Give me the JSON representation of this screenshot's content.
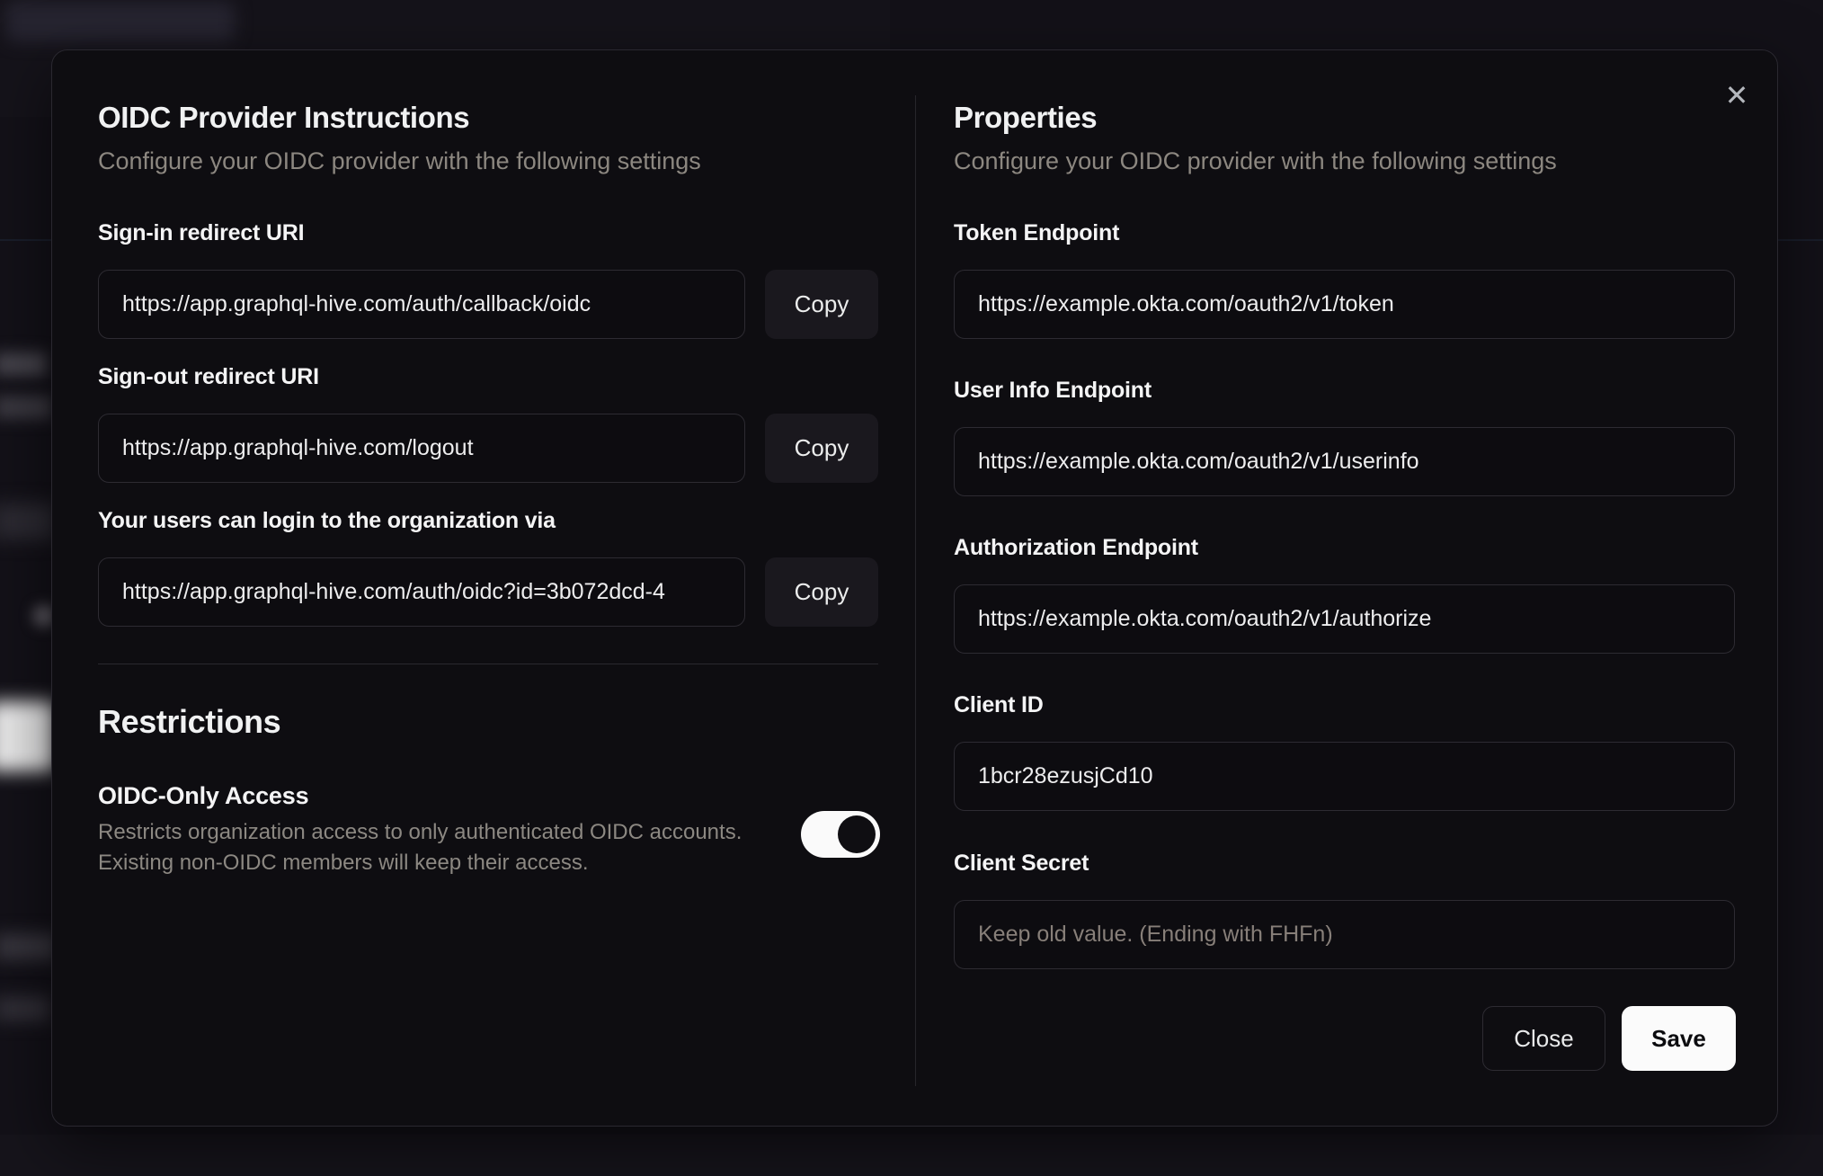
{
  "modal": {
    "close_icon": "✕",
    "left": {
      "title": "OIDC Provider Instructions",
      "subtitle": "Configure your OIDC provider with the following settings",
      "fields": [
        {
          "label": "Sign-in redirect URI",
          "value": "https://app.graphql-hive.com/auth/callback/oidc",
          "copy_label": "Copy"
        },
        {
          "label": "Sign-out redirect URI",
          "value": "https://app.graphql-hive.com/logout",
          "copy_label": "Copy"
        },
        {
          "label": "Your users can login to the organization via",
          "value": "https://app.graphql-hive.com/auth/oidc?id=3b072dcd-4",
          "copy_label": "Copy"
        }
      ],
      "restrictions": {
        "title": "Restrictions",
        "toggle_label": "OIDC-Only Access",
        "toggle_description": "Restricts organization access to only authenticated OIDC accounts.\nExisting non-OIDC members will keep their access.",
        "toggle_state": "on"
      }
    },
    "right": {
      "title": "Properties",
      "subtitle": "Configure your OIDC provider with the following settings",
      "fields": [
        {
          "label": "Token Endpoint",
          "value": "https://example.okta.com/oauth2/v1/token"
        },
        {
          "label": "User Info Endpoint",
          "value": "https://example.okta.com/oauth2/v1/userinfo"
        },
        {
          "label": "Authorization Endpoint",
          "value": "https://example.okta.com/oauth2/v1/authorize"
        },
        {
          "label": "Client ID",
          "value": "1bcr28ezusjCd10"
        },
        {
          "label": "Client Secret",
          "value": "",
          "placeholder": "Keep old value. (Ending with FHFn)"
        }
      ],
      "buttons": {
        "close": "Close",
        "save": "Save"
      }
    }
  },
  "colors": {
    "page_background": "#131118",
    "modal_background": "#0e0d11",
    "modal_border": "#2a2830",
    "input_border": "#2d2b32",
    "copy_button_background": "#1a181e",
    "primary_text": "#f0f1f2",
    "muted_text": "#8c8780",
    "save_button_background": "#fbfbfb",
    "save_button_text": "#0c0c0f",
    "toggle_on": "#fafafa",
    "toggle_knob": "#0f0e12"
  }
}
